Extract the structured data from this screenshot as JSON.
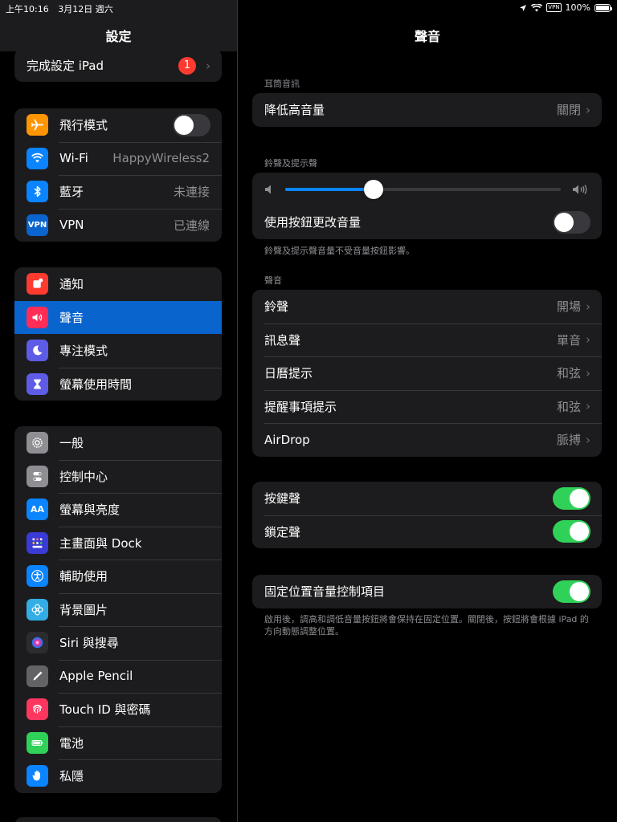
{
  "status_bar": {
    "time": "上午10:16",
    "date": "3月12日 週六",
    "vpn": "VPN",
    "battery": "100%"
  },
  "sidebar": {
    "title": "設定",
    "setup": {
      "label": "完成設定 iPad",
      "badge": "1"
    },
    "group1": [
      {
        "label": "飛行模式",
        "icon": "airplane-icon",
        "color": "#ff9500",
        "toggle": false
      },
      {
        "label": "Wi-Fi",
        "value": "HappyWireless2",
        "icon": "wifi-icon",
        "color": "#0a84ff"
      },
      {
        "label": "藍牙",
        "value": "未連接",
        "icon": "bluetooth-icon",
        "color": "#0a84ff"
      },
      {
        "label": "VPN",
        "value": "已連線",
        "icon": "vpn-icon",
        "color": "#0a64ce"
      }
    ],
    "group2": [
      {
        "label": "通知",
        "icon": "notifications-icon",
        "color": "#ff3b30"
      },
      {
        "label": "聲音",
        "icon": "speaker-icon",
        "color": "#ff2d55",
        "selected": true
      },
      {
        "label": "專注模式",
        "icon": "moon-icon",
        "color": "#5e5ce6"
      },
      {
        "label": "螢幕使用時間",
        "icon": "hourglass-icon",
        "color": "#5e5ce6"
      }
    ],
    "group3": [
      {
        "label": "一般",
        "icon": "gear-icon",
        "color": "#8e8e93"
      },
      {
        "label": "控制中心",
        "icon": "switches-icon",
        "color": "#8e8e93"
      },
      {
        "label": "螢幕與亮度",
        "icon": "text-size-icon",
        "color": "#0a84ff"
      },
      {
        "label": "主畫面與 Dock",
        "icon": "home-grid-icon",
        "color": "#3a3ad6"
      },
      {
        "label": "輔助使用",
        "icon": "accessibility-icon",
        "color": "#0a84ff"
      },
      {
        "label": "背景圖片",
        "icon": "flower-icon",
        "color": "#32ade6"
      },
      {
        "label": "Siri 與搜尋",
        "icon": "siri-icon",
        "color": "#2c2c2e"
      },
      {
        "label": "Apple Pencil",
        "icon": "pencil-icon",
        "color": "#636366"
      },
      {
        "label": "Touch ID 與密碼",
        "icon": "fingerprint-icon",
        "color": "#ff375f"
      },
      {
        "label": "電池",
        "icon": "battery-icon",
        "color": "#30d158"
      },
      {
        "label": "私隱",
        "icon": "hand-icon",
        "color": "#0a84ff"
      }
    ]
  },
  "main": {
    "title": "聲音",
    "headphone_section": {
      "header": "耳筒音訊",
      "row": {
        "label": "降低高音量",
        "value": "關閉"
      }
    },
    "ringer_section": {
      "header": "鈴聲及提示聲",
      "volume_level": 0.32,
      "change_with_buttons": {
        "label": "使用按鈕更改音量",
        "toggle": false
      },
      "footer": "鈴聲及提示聲音量不受音量按鈕影響。"
    },
    "sounds_section": {
      "header": "聲音",
      "rows": [
        {
          "label": "鈴聲",
          "value": "開場"
        },
        {
          "label": "訊息聲",
          "value": "單音"
        },
        {
          "label": "日曆提示",
          "value": "和弦"
        },
        {
          "label": "提醒事項提示",
          "value": "和弦"
        },
        {
          "label": "AirDrop",
          "value": "脈搏"
        }
      ]
    },
    "clicks_section": {
      "rows": [
        {
          "label": "按鍵聲",
          "toggle": true
        },
        {
          "label": "鎖定聲",
          "toggle": true
        }
      ]
    },
    "fixed_section": {
      "row": {
        "label": "固定位置音量控制項目",
        "toggle": true
      },
      "footer": "啟用後，調高和調低音量按鈕將會保持在固定位置。關閉後，按鈕將會根據 iPad 的方向動態調整位置。"
    }
  }
}
